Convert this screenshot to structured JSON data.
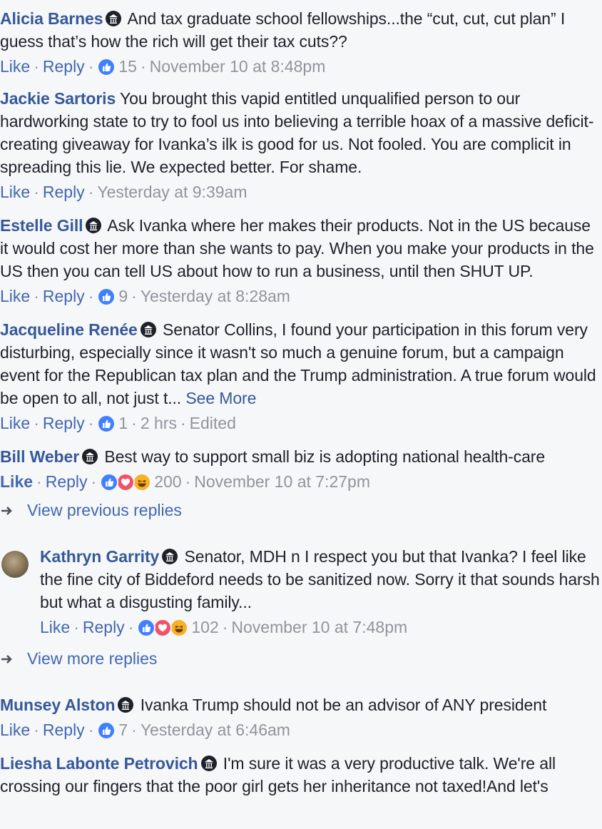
{
  "comments": [
    {
      "author": "Alicia Barnes",
      "text": " And tax graduate school fellowships...the “cut, cut, cut plan” I guess that’s how the rich will get their tax cuts??",
      "like": "Like",
      "reply": "Reply",
      "count": "15",
      "time": "November 10 at 8:48pm"
    },
    {
      "author": "Jackie Sartoris",
      "text": " You brought this vapid entitled unqualified person to our hardworking state to try to fool us into believing a terrible hoax of a massive deficit-creating giveaway for Ivanka’s ilk is good for us. Not fooled. You are complicit in spreading this lie. We expected better. For shame.",
      "like": "Like",
      "reply": "Reply",
      "time": "Yesterday at 9:39am"
    },
    {
      "author": "Estelle Gill",
      "text": " Ask Ivanka where her makes their products. Not in the US because it would cost her more than she wants to pay. When you make your products in the US then you can tell US about how to run a business, until then SHUT UP.",
      "like": "Like",
      "reply": "Reply",
      "count": "9",
      "time": "Yesterday at 8:28am"
    },
    {
      "author": "Jacqueline Renée",
      "text": " Senator Collins, I found your participation in this forum very disturbing, especially since it wasn't so much a genuine forum, but a campaign event for the Republican tax plan and the Trump administration. A true forum would be open to all, not just t... ",
      "see_more": "See More",
      "like": "Like",
      "reply": "Reply",
      "count": "1",
      "time": "2 hrs",
      "edited": "Edited"
    },
    {
      "author": "Bill Weber",
      "text": " Best way to support small biz is adopting national health-care",
      "like": "Like",
      "reply": "Reply",
      "count": "200",
      "time": "November 10 at 7:27pm"
    }
  ],
  "view_previous": "View previous replies",
  "reply_comment": {
    "author": "Kathryn Garrity",
    "text": " Senator, MDH n I respect you but that Ivanka? I feel like the fine city of Biddeford needs to be sanitized now. Sorry it that sounds harsh but what a disgusting family...",
    "like": "Like",
    "reply": "Reply",
    "count": "102",
    "time": "November 10 at 7:48pm"
  },
  "view_more": "View more replies",
  "comments2": [
    {
      "author": "Munsey Alston",
      "text": " Ivanka Trump should not be an advisor of ANY president",
      "like": "Like",
      "reply": "Reply",
      "count": "7",
      "time": "Yesterday at 6:46am"
    },
    {
      "author": "Liesha Labonte Petrovich",
      "text": " I'm sure it was a very productive talk. We're all crossing our fingers that the poor girl gets her inheritance not taxed!And let's"
    }
  ],
  "icons": {
    "badge": "government-badge-icon",
    "like": "like-reaction-icon",
    "love": "love-reaction-icon",
    "haha": "haha-reaction-icon",
    "arrow": "reply-arrow-icon"
  },
  "colors": {
    "author": "#365899",
    "link": "#4267b2",
    "meta": "#90949c",
    "text": "#1d2129",
    "background": "#f6f7f9"
  }
}
